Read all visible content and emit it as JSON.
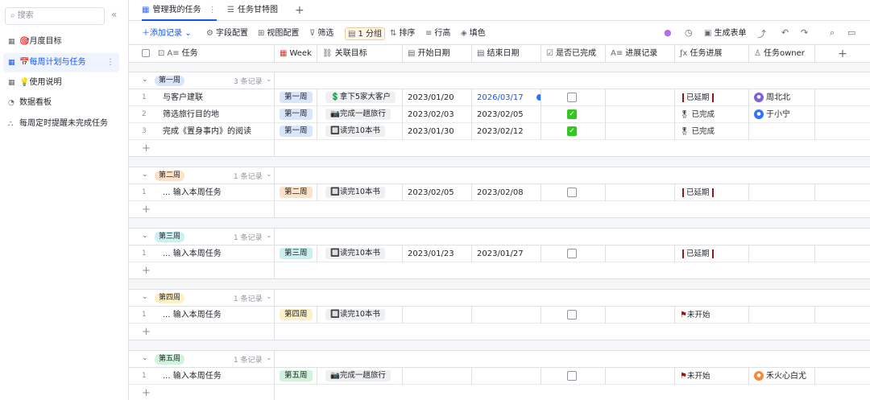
{
  "sidebar": {
    "search_placeholder": "搜索",
    "collapse_icon": "«",
    "items": [
      {
        "label": "🎯月度目标",
        "icon": "table-icon",
        "active": false
      },
      {
        "label": "📅每周计划与任务",
        "icon": "table-icon",
        "active": true
      },
      {
        "label": "💡使用说明",
        "icon": "table-icon",
        "active": false
      },
      {
        "label": "数据看板",
        "icon": "dashboard-icon",
        "active": false
      },
      {
        "label": "每周定时提醒未完成任务",
        "icon": "automation-icon",
        "active": false
      }
    ],
    "more_icon": "⋮"
  },
  "tabs": {
    "active_label": "管理我的任务",
    "second_label": "任务甘特图",
    "add_label": "+"
  },
  "toolbar": {
    "add_record": "＋添加记录",
    "field_config": "字段配置",
    "view_config": "视图配置",
    "filter": "筛选",
    "group": "1 分组",
    "sort": "排序",
    "row_height": "行高",
    "fill_color": "填色",
    "generate_form": "生成表单"
  },
  "columns": [
    "任务",
    "Week",
    "关联目标",
    "开始日期",
    "结束日期",
    "是否已完成",
    "进展记录",
    "任务进展",
    "任务owner"
  ],
  "groups": [
    {
      "name": "第一周",
      "count": "3 条记录",
      "color": "#d9e5fb",
      "rows": [
        {
          "num": "1",
          "task": "与客户建联",
          "week": "第一周",
          "goal": "💲拿下5家大客户",
          "start": "2023/01/20",
          "end": "2026/03/17",
          "end_blue": true,
          "done": false,
          "progress": "已延期",
          "progress_type": "delayed",
          "owner": "周北北",
          "owner_color": "#7f5fe0"
        },
        {
          "num": "2",
          "task": "筛选旅行目的地",
          "week": "第一周",
          "goal": "📷完成一趟旅行",
          "start": "2023/02/03",
          "end": "2023/02/05",
          "done": true,
          "progress": "已完成",
          "progress_type": "done",
          "owner": "于小宁",
          "owner_color": "#3370ff"
        },
        {
          "num": "3",
          "task": "完成《置身事内》的阅读",
          "week": "第一周",
          "goal": "🔲读完10本书",
          "start": "2023/01/30",
          "end": "2023/02/12",
          "done": true,
          "progress": "已完成",
          "progress_type": "done",
          "owner": "",
          "owner_color": ""
        }
      ]
    },
    {
      "name": "第二周",
      "count": "1 条记录",
      "color": "#fde2c7",
      "rows": [
        {
          "num": "1",
          "task": "... 输入本周任务",
          "week": "第二周",
          "goal": "🔲读完10本书",
          "start": "2023/02/05",
          "end": "2023/02/08",
          "done": false,
          "progress": "已延期",
          "progress_type": "delayed",
          "owner": "",
          "owner_color": ""
        }
      ]
    },
    {
      "name": "第三周",
      "count": "1 条记录",
      "color": "#caf0f0",
      "rows": [
        {
          "num": "1",
          "task": "... 输入本周任务",
          "week": "第三周",
          "goal": "🔲读完10本书",
          "start": "2023/01/23",
          "end": "2023/01/27",
          "done": false,
          "progress": "已延期",
          "progress_type": "delayed",
          "owner": "",
          "owner_color": ""
        }
      ]
    },
    {
      "name": "第四周",
      "count": "1 条记录",
      "color": "#fef1c7",
      "rows": [
        {
          "num": "1",
          "task": "... 输入本周任务",
          "week": "第四周",
          "goal": "🔲读完10本书",
          "start": "",
          "end": "",
          "done": false,
          "progress": "未开始",
          "progress_type": "todo",
          "owner": "",
          "owner_color": ""
        }
      ]
    },
    {
      "name": "第五周",
      "count": "1 条记录",
      "color": "#d1f3dc",
      "rows": [
        {
          "num": "1",
          "task": "... 输入本周任务",
          "week": "第五周",
          "goal": "📷完成一趟旅行",
          "start": "",
          "end": "",
          "done": false,
          "progress": "未开始",
          "progress_type": "todo",
          "owner": "禾火心白尤",
          "owner_color": "#f58a3c"
        }
      ]
    }
  ]
}
